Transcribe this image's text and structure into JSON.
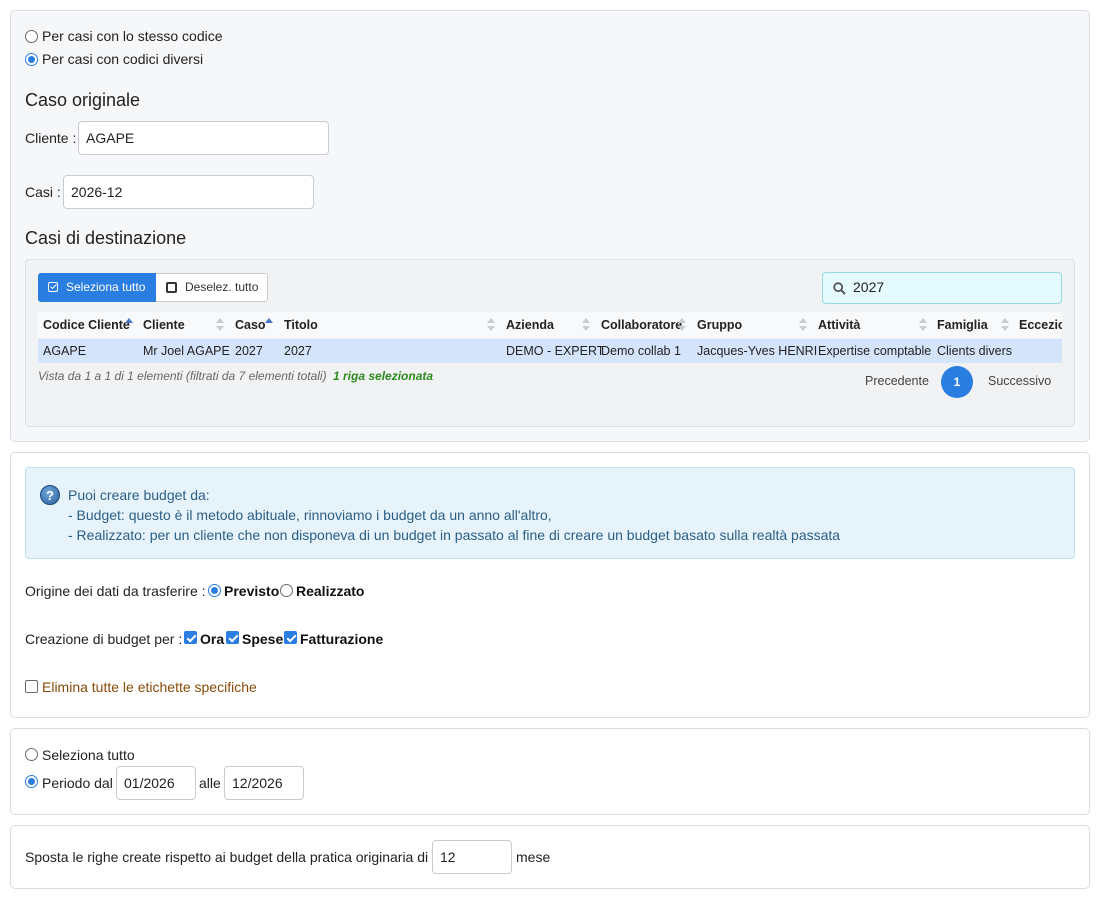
{
  "source_mode": {
    "same_code_label": "Per casi con lo stesso codice",
    "diff_code_label": "Per casi con codici diversi",
    "selected": "diff_code"
  },
  "original": {
    "heading": "Caso originale",
    "client_label": "Cliente :",
    "client_value": "AGAPE",
    "case_label": "Casi :",
    "case_value": "2026-12"
  },
  "destination": {
    "heading": "Casi di destinazione",
    "select_all_label": "Seleziona tutto",
    "deselect_all_label": "Deselez. tutto",
    "search_value": "2027",
    "columns": [
      "Codice Cliente",
      "Cliente",
      "Caso",
      "Titolo",
      "Azienda",
      "Collaboratore",
      "Gruppo",
      "Attività",
      "Famiglia",
      "Eccezio"
    ],
    "rows": [
      [
        "AGAPE",
        "Mr Joel AGAPE",
        "2027",
        "2027",
        "DEMO - EXPERT",
        "Demo collab 1",
        "Jacques-Yves HENRI",
        "Expertise comptable",
        "Clients divers",
        ""
      ]
    ],
    "info_text": "Vista da 1 a 1 di 1 elementi (filtrati da 7 elementi totali)",
    "selected_text": "1 riga selezionata",
    "prev_label": "Precedente",
    "page": "1",
    "next_label": "Successivo"
  },
  "help": {
    "line1": "Puoi creare budget da:",
    "line2": "- Budget: questo è il metodo abituale, rinnoviamo i budget da un anno all'altro,",
    "line3": "- Realizzato: per un cliente che non disponeva di un budget in passato al fine di creare un budget basato sulla realtà passata"
  },
  "data_origin": {
    "label": "Origine dei dati da trasferire :",
    "opt1": "Previsto",
    "opt2": "Realizzato",
    "selected": "Previsto"
  },
  "budget_for": {
    "label": "Creazione di budget per :",
    "opt_hours": "Ora",
    "opt_expenses": "Spese",
    "opt_billing": "Fatturazione"
  },
  "remove_labels": "Elimina tutte le etichette specifiche",
  "period": {
    "select_all_label": "Seleziona tutto",
    "from_label": "Periodo dal",
    "from_value": "01/2026",
    "to_label": "alle",
    "to_value": "12/2026"
  },
  "shift": {
    "label": "Sposta le righe create rispetto ai budget della pratica originaria di",
    "value": "12",
    "unit": "mese"
  },
  "colors": {
    "accent": "#2a7de1",
    "row_selected": "#d4e4fb",
    "help_bg": "#e6f3fb",
    "help_text": "#2c5e86",
    "green": "#2e8b1e",
    "brown": "#8a4b08"
  }
}
